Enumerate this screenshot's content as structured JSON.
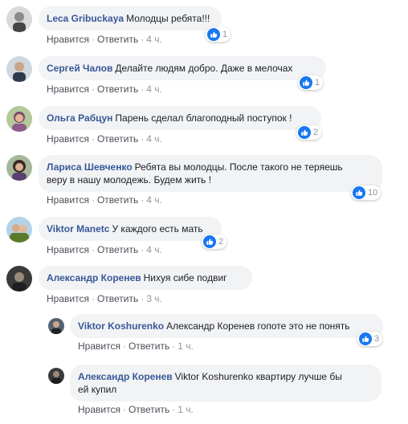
{
  "comments": [
    {
      "author": "Leca Gribuckaya",
      "text": "Молодцы ребята!!!",
      "likes": "1",
      "like": "Нравится",
      "reply": "Ответить",
      "time": "4 ч.",
      "sep1": "·",
      "sep2": "·"
    },
    {
      "author": "Сергей Чалов",
      "text": "Делайте людям добро. Даже в мелочах",
      "likes": "1",
      "like": "Нравится",
      "reply": "Ответить",
      "time": "4 ч.",
      "sep1": "·",
      "sep2": "·"
    },
    {
      "author": "Ольга Рабцун",
      "text": "Парень сделал благоподный поступок !",
      "likes": "2",
      "like": "Нравится",
      "reply": "Ответить",
      "time": "4 ч.",
      "sep1": "·",
      "sep2": "·"
    },
    {
      "author": "Лариса Шевченко",
      "text_line1": "Ребята вы молодцы. После такого не теряешь",
      "text_line2": "веру в нашу молодежь. Будем жить !",
      "likes": "10",
      "like": "Нравится",
      "reply": "Ответить",
      "time": "4 ч.",
      "sep1": "·",
      "sep2": "·"
    },
    {
      "author": "Viktor Manetc",
      "text": "У каждого есть мать",
      "likes": "2",
      "like": "Нравится",
      "reply": "Ответить",
      "time": "4 ч.",
      "sep1": "·",
      "sep2": "·"
    },
    {
      "author": "Александр Коренев",
      "text": "Нихуя сибе подвиг",
      "like": "Нравится",
      "reply": "Ответить",
      "time": "3 ч.",
      "sep1": "·",
      "sep2": "·"
    }
  ],
  "replies": [
    {
      "author": "Viktor Koshurenko",
      "text": "Александр Коренев гопоте это не понять",
      "likes": "3",
      "like": "Нравится",
      "reply": "Ответить",
      "time": "1 ч.",
      "sep1": "·",
      "sep2": "·"
    },
    {
      "author": "Александр Коренев",
      "text_line1": "Viktor Koshurenko квартиру лучше бы",
      "text_line2": "ей купил",
      "like": "Нравится",
      "reply": "Ответить",
      "time": "1 ч.",
      "sep1": "·",
      "sep2": "·"
    }
  ],
  "colors": {
    "author": "#385898",
    "bubble": "#f2f3f5",
    "like": "#1877f2",
    "meta": "#90949c"
  },
  "icons": {
    "like": "thumbs-up-icon"
  }
}
